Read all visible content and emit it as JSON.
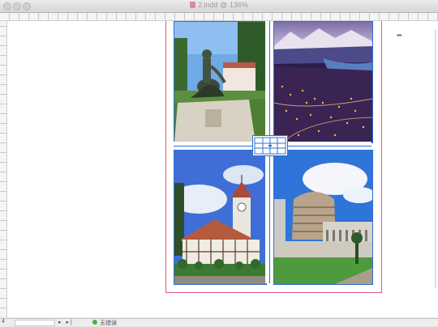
{
  "window": {
    "title": "2.indd @ 136%",
    "controls": [
      "close",
      "minimize",
      "zoom"
    ]
  },
  "canvas": {
    "photos": [
      {
        "name": "mermaid-statue",
        "icon": "statue-photo"
      },
      {
        "name": "city-lights-lake",
        "icon": "city-night-photo"
      },
      {
        "name": "clock-tower-building",
        "icon": "tudor-building-photo"
      },
      {
        "name": "beehive-parliament",
        "icon": "parliament-photo"
      }
    ],
    "accent_color": "#2f6fd0",
    "margin_color": "#e05a73"
  },
  "statusbar": {
    "zoom_label": "4",
    "page_value": "",
    "nav_glyphs": "▸ ▸|",
    "status_text": "无错误"
  }
}
